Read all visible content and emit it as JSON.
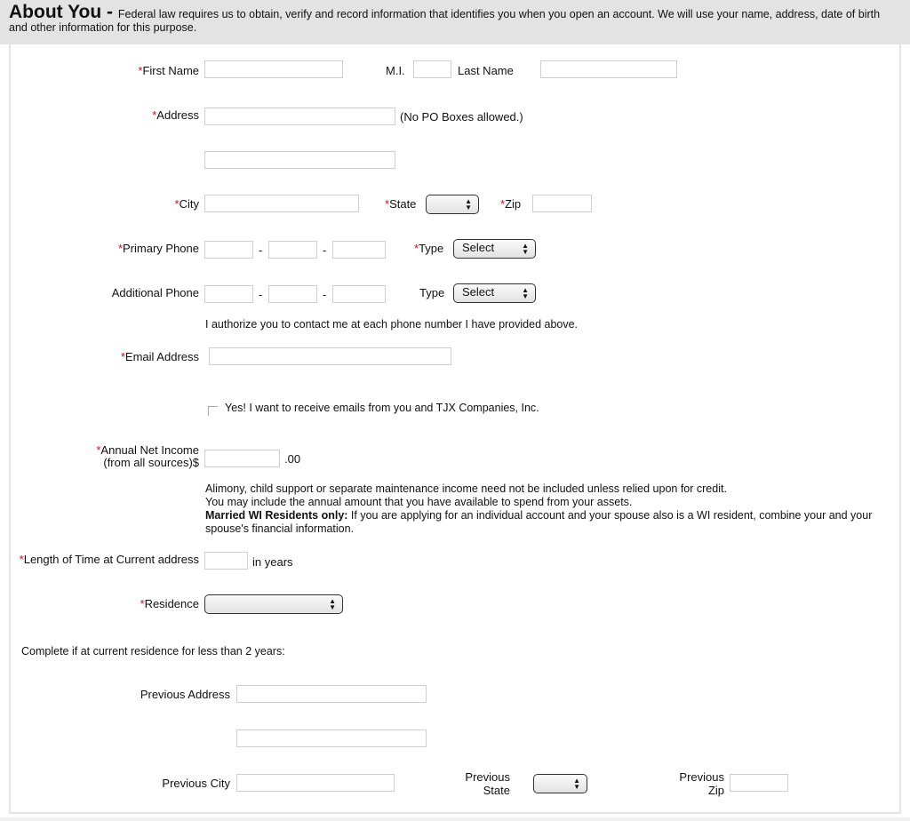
{
  "header": {
    "title": "About You",
    "separator": " - ",
    "description": "Federal law requires us to obtain, verify and record information that identifies you when you open an account. We will use your name, address, date of birth and other information for this purpose."
  },
  "required_marker": "*",
  "fields": {
    "first_name": {
      "label": "First Name",
      "value": ""
    },
    "mi": {
      "label": "M.I.",
      "value": ""
    },
    "last_name": {
      "label": "Last Name",
      "value": ""
    },
    "address": {
      "label": "Address",
      "value": "",
      "line2_value": "",
      "hint": "(No PO Boxes allowed.)"
    },
    "city": {
      "label": "City",
      "value": ""
    },
    "state": {
      "label": "State",
      "selected": ""
    },
    "zip": {
      "label": "Zip",
      "value": ""
    },
    "primary_phone": {
      "label": "Primary Phone",
      "separator": "-",
      "type_label": "Type",
      "type_selected": "Select"
    },
    "additional_phone": {
      "label": "Additional Phone",
      "separator": "-",
      "type_label": "Type",
      "type_selected": "Select"
    },
    "phone_authorization": "I authorize you to contact me at each phone number I have provided above.",
    "email": {
      "label": "Email Address",
      "value": ""
    },
    "email_optin": {
      "label": "Yes! I want to receive emails from you and TJX Companies, Inc.",
      "checked": false
    },
    "income": {
      "label_line1": "Annual Net Income",
      "label_line2": "(from all sources)$",
      "suffix": ".00",
      "value": ""
    },
    "income_notes": {
      "line1": "Alimony, child support or separate maintenance income need not be included unless relied upon for credit.",
      "line2": "You may include the annual amount that you have available to spend from your assets.",
      "line3_bold": "Married WI Residents only:",
      "line3_rest": " If you are applying for an individual account and your spouse also is a WI resident, combine your and your spouse's financial information."
    },
    "length_at_address": {
      "label": "Length of Time at Current address",
      "suffix": "in years",
      "value": ""
    },
    "residence": {
      "label": "Residence",
      "selected": ""
    },
    "previous_note": "Complete if at current residence for less than 2 years:",
    "previous_address": {
      "label": "Previous Address",
      "value": "",
      "line2_value": ""
    },
    "previous_city": {
      "label": "Previous City",
      "value": ""
    },
    "previous_state": {
      "label_line1": "Previous",
      "label_line2": "State",
      "selected": ""
    },
    "previous_zip": {
      "label_line1": "Previous",
      "label_line2": "Zip",
      "value": ""
    }
  }
}
